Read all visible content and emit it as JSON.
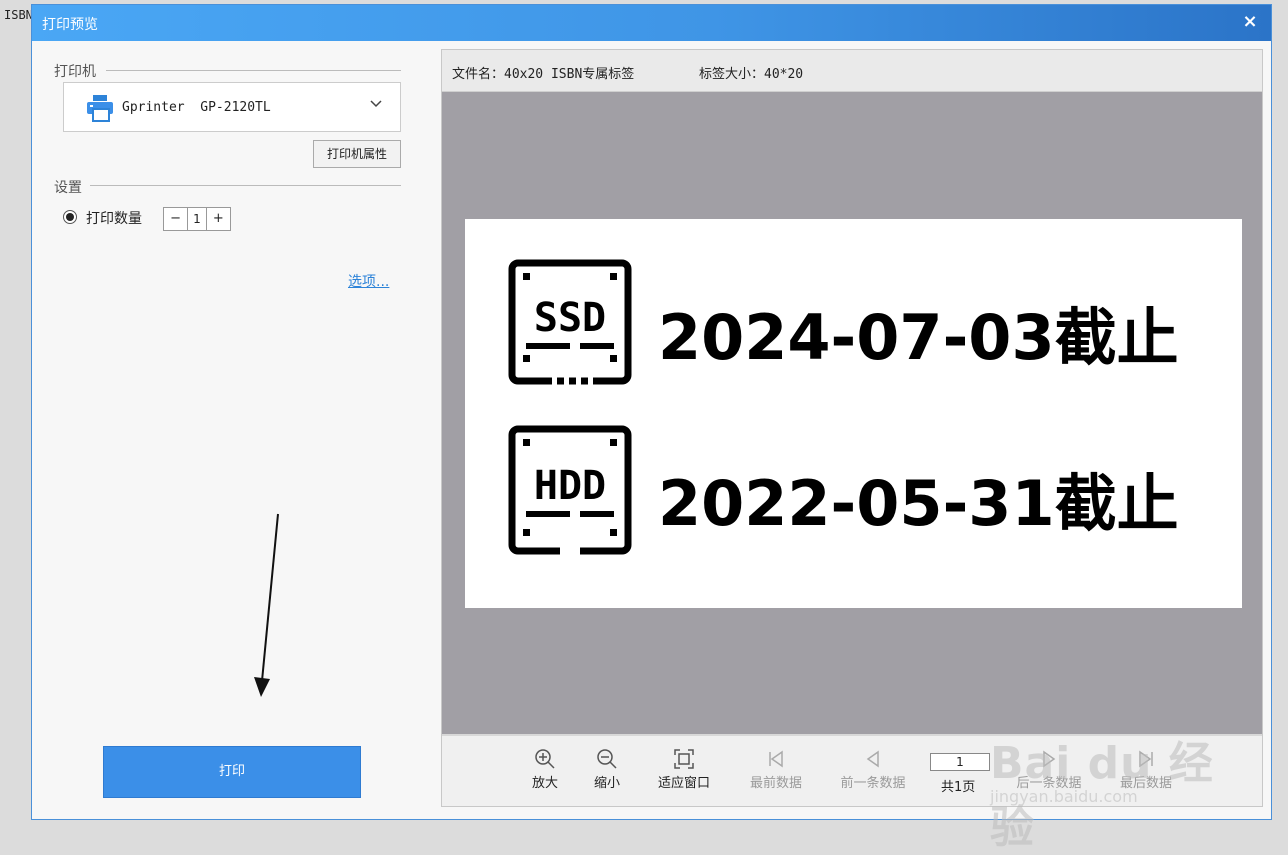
{
  "background": {
    "text": "ISBN"
  },
  "dialog": {
    "title": "打印预览",
    "close_label": "×"
  },
  "left": {
    "printer_section": "打印机",
    "printer_name": "Gprinter  GP-2120TL",
    "printer_props_label": "打印机属性",
    "settings_section": "设置",
    "qty_label": "打印数量",
    "qty_minus": "−",
    "qty_value": "1",
    "qty_plus": "+",
    "options_label": "选项...",
    "print_label": "打印"
  },
  "preview": {
    "filename_label": "文件名：40x20 ISBN专属标签",
    "size_label": "标签大小：40*20",
    "label": {
      "rows": [
        {
          "icon": "ssd-icon",
          "icon_text": "SSD",
          "date": "2024-07-03截止"
        },
        {
          "icon": "hdd-icon",
          "icon_text": "HDD",
          "date": "2022-05-31截止"
        }
      ]
    }
  },
  "toolbar": {
    "zoom_in": "放大",
    "zoom_out": "缩小",
    "fit_window": "适应窗口",
    "first_record": "最前数据",
    "prev_record": "前一条数据",
    "page_value": "1",
    "total_pages": "共1页",
    "next_record": "后一条数据",
    "last_record": "最后数据"
  },
  "watermark": {
    "line1": "Bai du 经验",
    "line2": "jingyan.baidu.com"
  },
  "colors": {
    "accent": "#3b8fe8",
    "titlebar": "#4aa7f5",
    "preview_bg": "#a19fa5",
    "link": "#2d83d8"
  }
}
